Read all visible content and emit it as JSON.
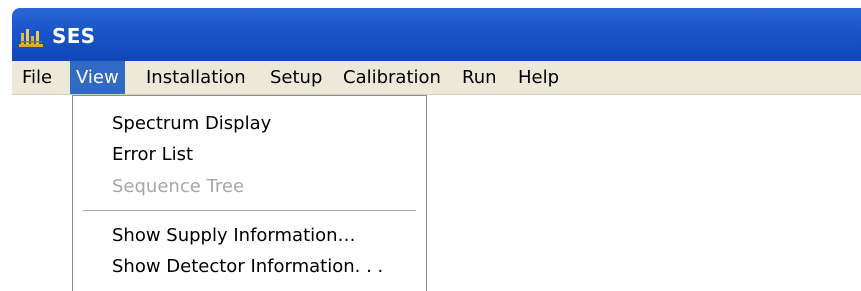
{
  "window": {
    "title": "SES",
    "icon": "ses-app-icon"
  },
  "menubar": {
    "items": [
      {
        "label": "File"
      },
      {
        "label": "View"
      },
      {
        "label": "Installation"
      },
      {
        "label": "Setup"
      },
      {
        "label": "Calibration"
      },
      {
        "label": "Run"
      },
      {
        "label": "Help"
      }
    ],
    "active": "View"
  },
  "view_menu": {
    "items": [
      {
        "label": "Spectrum Display",
        "enabled": true
      },
      {
        "label": "Error List",
        "enabled": true
      },
      {
        "label": "Sequence Tree",
        "enabled": false
      },
      {
        "label": "Show Supply Information…",
        "enabled": true
      },
      {
        "label": "Show Detector Information. . .",
        "enabled": true
      }
    ]
  },
  "colors": {
    "titlebar": "#1a56c9",
    "menubar": "#ece9d8",
    "highlight": "#316ac5",
    "disabled_text": "#a7a6aa"
  }
}
